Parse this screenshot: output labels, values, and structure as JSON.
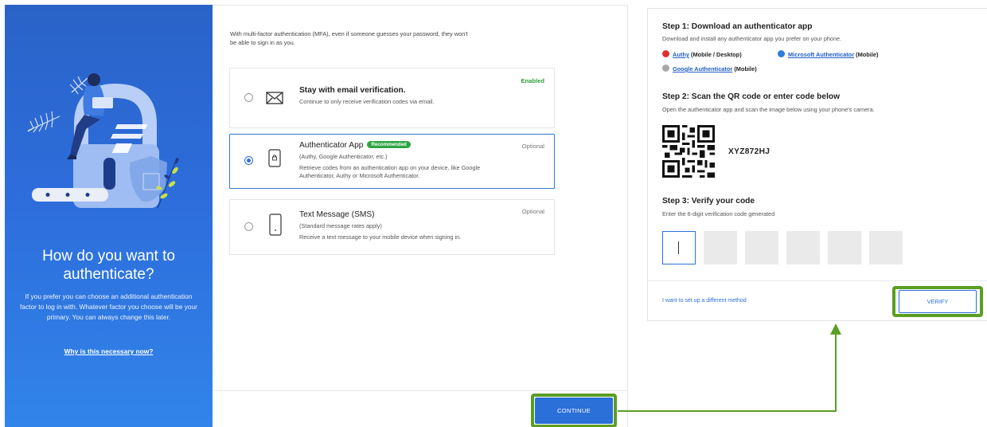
{
  "hero": {
    "title": "How do you want to authenticate?",
    "description": "If you prefer you can choose an additional authentication factor to log in with. Whatever factor you choose will be your primary. You can always change this later.",
    "link": "Why is this necessary now?"
  },
  "options_panel": {
    "intro": "With multi-factor authentication (MFA), even if someone guesses your password, they won't be able to sign in as you.",
    "options": [
      {
        "title": "Stay with email verification.",
        "subtitle": "",
        "description": "Continue to only receive verification codes via email.",
        "status": "Enabled",
        "icon": "envelope-icon",
        "selected": false
      },
      {
        "title": "Authenticator App",
        "badge": "Recommended",
        "subtitle": "(Authy, Google Authenticator, etc.)",
        "description": "Retrieve codes from an authentication app on your device, like Google Authenticator, Authy or Microsoft Authenticator.",
        "status": "Optional",
        "icon": "authenticator-phone-icon",
        "selected": true
      },
      {
        "title": "Text Message (SMS)",
        "subtitle": "(Standard message rates apply)",
        "description": "Receive a text message to your mobile device when signing in.",
        "status": "Optional",
        "icon": "mobile-phone-icon",
        "selected": false
      }
    ],
    "continue_label": "CONTINUE"
  },
  "setup": {
    "step1": {
      "title": "Step 1: Download an authenticator app",
      "text": "Download and install any authenticator app you prefer on your phone."
    },
    "apps": [
      {
        "link": "Authy",
        "platform": "(Mobile / Desktop)",
        "color": "#e0302f"
      },
      {
        "link": "Microsoft Authenticator",
        "platform": "(Mobile)",
        "color": "#2f7fe0"
      },
      {
        "link": "Google Authenticator",
        "platform": "(Mobile)",
        "color": "#a8a8a8"
      }
    ],
    "step2": {
      "title": "Step 2: Scan the QR code or enter code below",
      "text": "Open the authenticator app and scan the image below using your phone's camera."
    },
    "code": "XYZ872HJ",
    "step3": {
      "title": "Step 3: Verify your code",
      "text": "Enter the 6-digit verification code generated"
    },
    "digit_count": 6,
    "other_method": "I want to set up a different method",
    "verify_label": "VERIFY"
  },
  "colors": {
    "accent": "#2b6fd8",
    "highlight": "#5a9e22",
    "enabled": "#2e9c3a",
    "hero_bg": "#2d6ddb"
  }
}
